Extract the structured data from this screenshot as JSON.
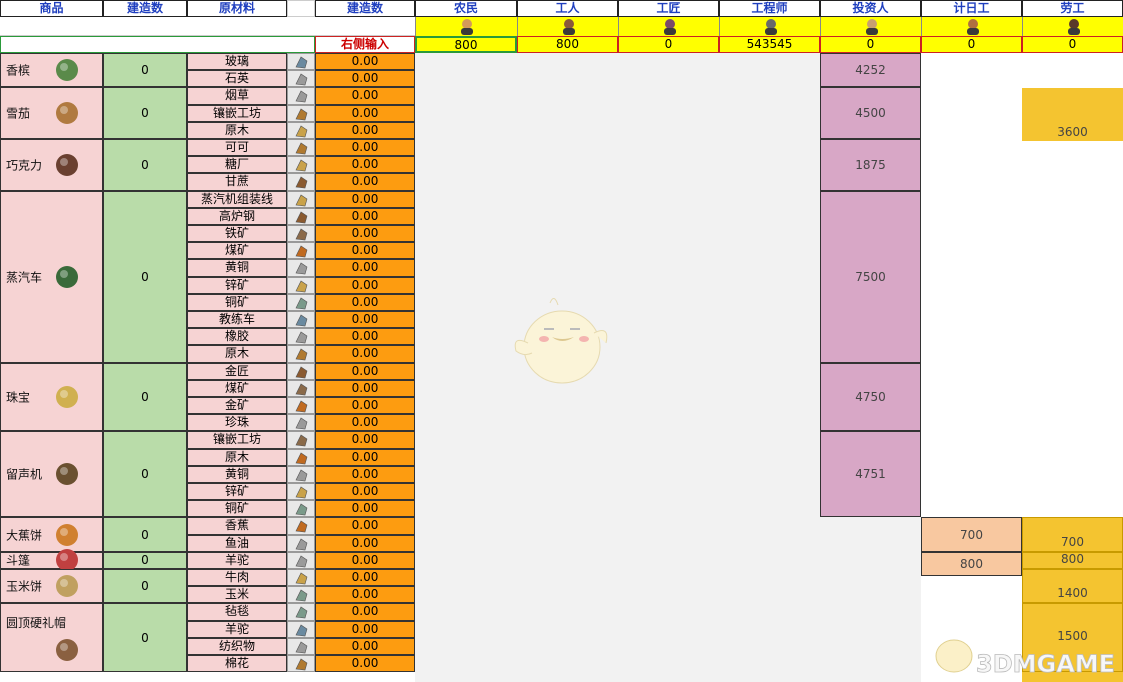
{
  "header": {
    "product": "商品",
    "build_count": "建造数",
    "materials": "原材料",
    "build_count2": "建造数",
    "input_hint": "右侧输入"
  },
  "classes": [
    {
      "name": "农民",
      "value": "800"
    },
    {
      "name": "工人",
      "value": "800"
    },
    {
      "name": "工匠",
      "value": "0"
    },
    {
      "name": "工程师",
      "value": "543545"
    },
    {
      "name": "投资人",
      "value": "0"
    },
    {
      "name": "计日工",
      "value": "0"
    },
    {
      "name": "劳工",
      "value": "0"
    }
  ],
  "products": [
    {
      "name": "香槟",
      "build": "0",
      "materials": [
        "玻璃",
        "石英"
      ],
      "investor": "4252"
    },
    {
      "name": "雪茄",
      "build": "0",
      "materials": [
        "烟草",
        "镶嵌工坊",
        "原木"
      ],
      "investor": "4500",
      "laborer": "3600"
    },
    {
      "name": "巧克力",
      "build": "0",
      "materials": [
        "可可",
        "糖厂",
        "甘蔗"
      ],
      "investor": "1875"
    },
    {
      "name": "蒸汽车",
      "build": "0",
      "materials": [
        "蒸汽机组装线",
        "高炉钢",
        "铁矿",
        "煤矿",
        "黄铜",
        "锌矿",
        "铜矿",
        "教练车",
        "橡胶",
        "原木"
      ],
      "investor": "7500"
    },
    {
      "name": "珠宝",
      "build": "0",
      "materials": [
        "金匠",
        "煤矿",
        "金矿",
        "珍珠"
      ],
      "investor": "4750"
    },
    {
      "name": "留声机",
      "build": "0",
      "materials": [
        "镶嵌工坊",
        "原木",
        "黄铜",
        "锌矿",
        "铜矿"
      ],
      "investor": "4751"
    },
    {
      "name": "大蕉饼",
      "build": "0",
      "materials": [
        "香蕉",
        "鱼油"
      ],
      "dayworker": "700",
      "laborer": "700"
    },
    {
      "name": "斗篷",
      "build": "0",
      "materials": [
        "羊驼"
      ],
      "dayworker": "800",
      "laborer": "800"
    },
    {
      "name": "玉米饼",
      "build": "0",
      "materials": [
        "牛肉",
        "玉米"
      ],
      "laborer": "1400"
    },
    {
      "name": "圆顶硬礼帽",
      "build": "0",
      "materials": [
        "毡毯",
        "羊驼",
        "纺织物",
        "棉花"
      ],
      "laborer": "1500"
    }
  ],
  "material_value": "0.00",
  "watermark": "3DMGAME",
  "colors": {
    "header_text": "#1f3fbf",
    "product_bg": "#f6d3d3",
    "build_bg": "#b9dca9",
    "material_value_bg": "#fd9c10",
    "investor_bg": "#d8a7c6",
    "dayworker_bg": "#f8c8a0",
    "laborer_bg": "#f4c430",
    "input_row_bg": "#ffff00"
  }
}
